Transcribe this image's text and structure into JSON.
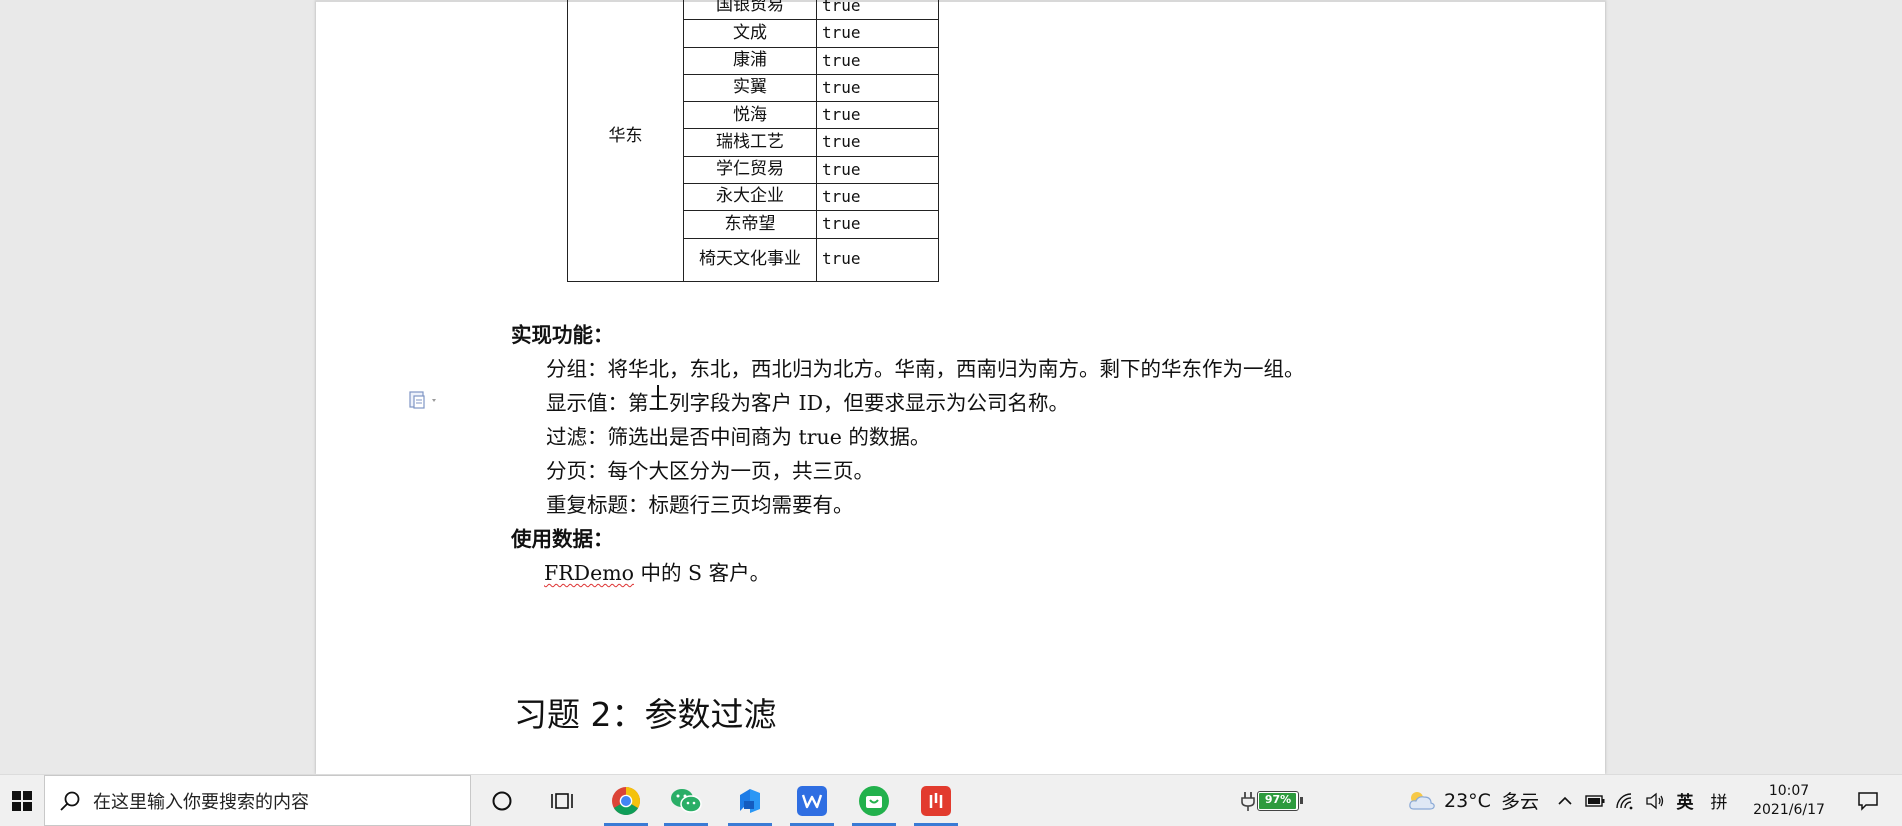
{
  "table": {
    "region": "华东",
    "rows": [
      {
        "name": "国银贸易",
        "value": "true"
      },
      {
        "name": "文成",
        "value": "true"
      },
      {
        "name": "康浦",
        "value": "true"
      },
      {
        "name": "实翼",
        "value": "true"
      },
      {
        "name": "悦海",
        "value": "true"
      },
      {
        "name": "瑞栈工艺",
        "value": "true"
      },
      {
        "name": "学仁贸易",
        "value": "true"
      },
      {
        "name": "永大企业",
        "value": "true"
      },
      {
        "name": "东帝望",
        "value": "true"
      },
      {
        "name": "椅天文化事业",
        "value": "true"
      }
    ]
  },
  "doc": {
    "features_heading": "实现功能：",
    "feature_lines": [
      "分组：将华北，东北，西北归为北方。华南，西南归为南方。剩下的华东作为一组。",
      "显示值：第二列字段为客户 ID，但要求显示为公司名称。",
      "过滤：筛选出是否中间商为 true 的数据。",
      "分页：每个大区分为一页，共三页。",
      "重复标题：标题行三页均需要有。"
    ],
    "data_heading": "使用数据：",
    "data_line_prefix": "FRDemo",
    "data_line_rest": " 中的 S 客户。",
    "section_title": "习题 2：参数过滤"
  },
  "taskbar": {
    "search_placeholder": "在这里输入你要搜索的内容",
    "battery_percent": "97%",
    "weather_temp": "23°C",
    "weather_desc": "多云",
    "ime_lang": "英",
    "ime_mode": "拼",
    "time": "10:07",
    "date": "2021/6/17",
    "apps": [
      "chrome-icon",
      "wechat-icon",
      "feishu-icon",
      "wps-icon",
      "shopping-icon",
      "netease-icon"
    ]
  },
  "colors": {
    "accent": "#3a7bd5",
    "battery": "#2e9b3e",
    "chrome_red": "#db4437",
    "wechat": "#2aae67",
    "wps": "#2f6ee2",
    "netease": "#e23b2e"
  }
}
